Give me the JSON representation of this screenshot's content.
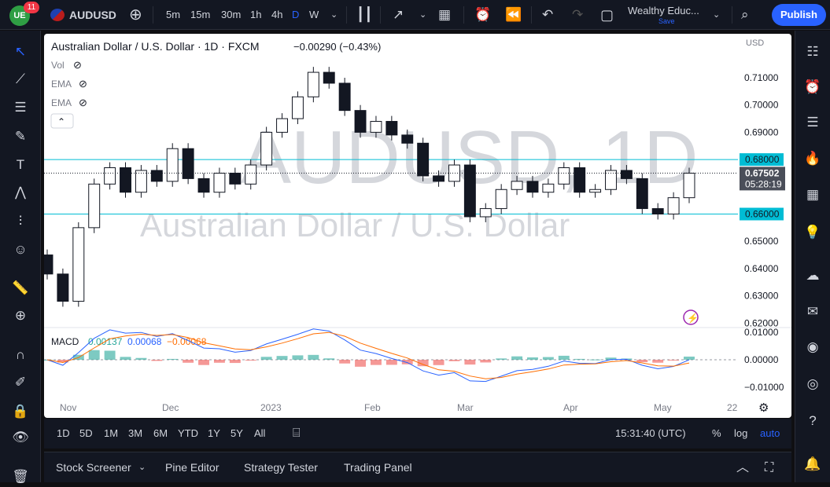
{
  "header": {
    "notification_count": "11",
    "symbol": "AUDUSD",
    "timeframes": [
      "5m",
      "15m",
      "30m",
      "1h",
      "4h",
      "D",
      "W"
    ],
    "active_timeframe": "D",
    "layout_name": "Wealthy Educ...",
    "layout_status": "Save",
    "publish_label": "Publish"
  },
  "legend": {
    "title": "Australian Dollar / U.S. Dollar · 1D · FXCM",
    "change": "−0.00290 (−0.43%)",
    "indicators": [
      "Vol",
      "EMA",
      "EMA"
    ]
  },
  "watermark": {
    "symbol": "AUDUSD, 1D",
    "name": "Australian Dollar / U.S. Dollar"
  },
  "price_axis": {
    "currency": "USD",
    "ticks": [
      "0.71000",
      "0.70000",
      "0.69000",
      "0.68000",
      "0.67000",
      "0.66000",
      "0.65000",
      "0.64000",
      "0.63000",
      "0.62000"
    ],
    "levels": [
      {
        "label": "0.68000",
        "value": 0.68
      },
      {
        "label": "0.66000",
        "value": 0.66
      }
    ],
    "last_price": "0.67502",
    "countdown": "05:28:19"
  },
  "macd": {
    "label": "MACD",
    "values": [
      "0.00137",
      "0.00068",
      "−0.00068"
    ],
    "ticks": [
      "0.01000",
      "0.00000",
      "−0.01000"
    ]
  },
  "time_axis": {
    "labels": [
      "Nov",
      "Dec",
      "2023",
      "Feb",
      "Mar",
      "Apr",
      "May",
      "22"
    ]
  },
  "bottom_bar": {
    "ranges": [
      "1D",
      "5D",
      "1M",
      "3M",
      "6M",
      "YTD",
      "1Y",
      "5Y",
      "All"
    ],
    "clock": "15:31:40 (UTC)",
    "percent_label": "%",
    "log_label": "log",
    "auto_label": "auto"
  },
  "panels": [
    "Stock Screener",
    "Pine Editor",
    "Strategy Tester",
    "Trading Panel"
  ],
  "colors": {
    "accent": "#2962ff",
    "level_line": "#00bcd4",
    "macd_line": "#2962ff",
    "signal_line": "#ff6d00",
    "hist_pos": "#26a69a",
    "hist_neg": "#ef5350"
  },
  "chart_data": {
    "type": "candlestick",
    "x_labels": [
      "Nov",
      "Dec",
      "2023",
      "Feb",
      "Mar",
      "Apr",
      "May"
    ],
    "closes": [
      0.638,
      0.628,
      0.655,
      0.671,
      0.677,
      0.668,
      0.676,
      0.672,
      0.684,
      0.673,
      0.668,
      0.675,
      0.671,
      0.678,
      0.69,
      0.695,
      0.703,
      0.712,
      0.708,
      0.698,
      0.69,
      0.694,
      0.689,
      0.686,
      0.674,
      0.672,
      0.678,
      0.659,
      0.662,
      0.669,
      0.672,
      0.668,
      0.671,
      0.677,
      0.668,
      0.669,
      0.676,
      0.673,
      0.662,
      0.66,
      0.666,
      0.675
    ]
  }
}
